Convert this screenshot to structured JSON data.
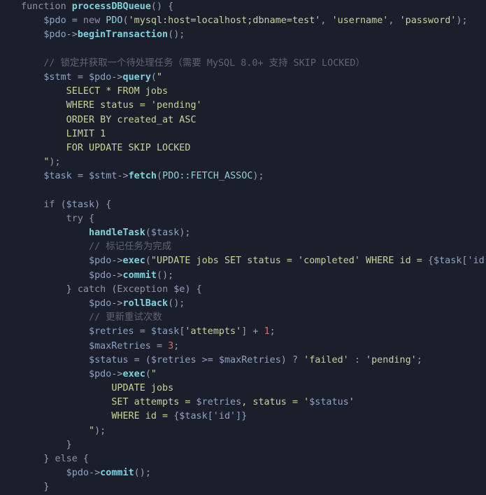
{
  "editor": {
    "language": "php",
    "theme_background": "#1b1f2b",
    "default_text_color": "#a9b1c2",
    "font_size_px": 13.4,
    "line_height_px": 20.2,
    "palette": {
      "keyword": "#8a93a8",
      "function_name": "#82d2d8",
      "method_name": "#7fd3e0",
      "variable": "#8fa3c4",
      "string": "#c3d69b",
      "comment": "#5c6576",
      "number": "#d2766b",
      "punctuation": "#97a0b3",
      "class_constant": "#8fd0d8"
    }
  },
  "code": {
    "title": "processDBQueue",
    "lines": [
      {
        "n": 1,
        "indent": 0,
        "tokens": [
          {
            "t": "function",
            "c": "kw"
          },
          {
            "t": " ",
            "c": "plain"
          },
          {
            "t": "processDBQueue",
            "c": "fnb"
          },
          {
            "t": "() {",
            "c": "punc"
          }
        ]
      },
      {
        "n": 2,
        "indent": 1,
        "tokens": [
          {
            "t": "$pdo",
            "c": "var"
          },
          {
            "t": " = ",
            "c": "op"
          },
          {
            "t": "new",
            "c": "kw"
          },
          {
            "t": " ",
            "c": "plain"
          },
          {
            "t": "PDO",
            "c": "const"
          },
          {
            "t": "(",
            "c": "punc"
          },
          {
            "t": "'mysql:host=localhost;dbname=test'",
            "c": "str"
          },
          {
            "t": ", ",
            "c": "punc"
          },
          {
            "t": "'username'",
            "c": "str"
          },
          {
            "t": ", ",
            "c": "punc"
          },
          {
            "t": "'password'",
            "c": "str"
          },
          {
            "t": ");",
            "c": "punc"
          }
        ]
      },
      {
        "n": 3,
        "indent": 1,
        "tokens": [
          {
            "t": "$pdo",
            "c": "var"
          },
          {
            "t": "->",
            "c": "op"
          },
          {
            "t": "beginTransaction",
            "c": "meth"
          },
          {
            "t": "();",
            "c": "punc"
          }
        ]
      },
      {
        "n": 4,
        "indent": 0,
        "tokens": []
      },
      {
        "n": 5,
        "indent": 1,
        "tokens": [
          {
            "t": "// 锁定并获取一个待处理任务（需要 MySQL 8.0+ 支持 SKIP LOCKED）",
            "c": "cmt"
          }
        ]
      },
      {
        "n": 6,
        "indent": 1,
        "tokens": [
          {
            "t": "$stmt",
            "c": "var"
          },
          {
            "t": " = ",
            "c": "op"
          },
          {
            "t": "$pdo",
            "c": "var"
          },
          {
            "t": "->",
            "c": "op"
          },
          {
            "t": "query",
            "c": "meth"
          },
          {
            "t": "(",
            "c": "punc"
          },
          {
            "t": "\"",
            "c": "str"
          }
        ]
      },
      {
        "n": 7,
        "indent": 2,
        "tokens": [
          {
            "t": "SELECT * FROM jobs",
            "c": "sql"
          }
        ]
      },
      {
        "n": 8,
        "indent": 2,
        "tokens": [
          {
            "t": "WHERE status = 'pending'",
            "c": "sql"
          }
        ]
      },
      {
        "n": 9,
        "indent": 2,
        "tokens": [
          {
            "t": "ORDER BY created_at ASC",
            "c": "sql"
          }
        ]
      },
      {
        "n": 10,
        "indent": 2,
        "tokens": [
          {
            "t": "LIMIT 1",
            "c": "sql"
          }
        ]
      },
      {
        "n": 11,
        "indent": 2,
        "tokens": [
          {
            "t": "FOR UPDATE SKIP LOCKED",
            "c": "sql"
          }
        ]
      },
      {
        "n": 12,
        "indent": 1,
        "tokens": [
          {
            "t": "\"",
            "c": "str"
          },
          {
            "t": ");",
            "c": "punc"
          }
        ]
      },
      {
        "n": 13,
        "indent": 1,
        "tokens": [
          {
            "t": "$task",
            "c": "var"
          },
          {
            "t": " = ",
            "c": "op"
          },
          {
            "t": "$stmt",
            "c": "var"
          },
          {
            "t": "->",
            "c": "op"
          },
          {
            "t": "fetch",
            "c": "meth"
          },
          {
            "t": "(",
            "c": "punc"
          },
          {
            "t": "PDO::FETCH_ASSOC",
            "c": "const"
          },
          {
            "t": ");",
            "c": "punc"
          }
        ]
      },
      {
        "n": 14,
        "indent": 0,
        "tokens": []
      },
      {
        "n": 15,
        "indent": 1,
        "tokens": [
          {
            "t": "if",
            "c": "kw"
          },
          {
            "t": " (",
            "c": "punc"
          },
          {
            "t": "$task",
            "c": "var"
          },
          {
            "t": ") {",
            "c": "punc"
          }
        ]
      },
      {
        "n": 16,
        "indent": 2,
        "tokens": [
          {
            "t": "try",
            "c": "kw"
          },
          {
            "t": " {",
            "c": "punc"
          }
        ]
      },
      {
        "n": 17,
        "indent": 3,
        "tokens": [
          {
            "t": "handleTask",
            "c": "fnb"
          },
          {
            "t": "(",
            "c": "punc"
          },
          {
            "t": "$task",
            "c": "var"
          },
          {
            "t": ");",
            "c": "punc"
          }
        ]
      },
      {
        "n": 18,
        "indent": 3,
        "tokens": [
          {
            "t": "// 标记任务为完成",
            "c": "cmt"
          }
        ]
      },
      {
        "n": 19,
        "indent": 3,
        "tokens": [
          {
            "t": "$pdo",
            "c": "var"
          },
          {
            "t": "->",
            "c": "op"
          },
          {
            "t": "exec",
            "c": "meth"
          },
          {
            "t": "(",
            "c": "punc"
          },
          {
            "t": "\"UPDATE jobs SET status = 'completed' WHERE id = ",
            "c": "str"
          },
          {
            "t": "{$task['id']}",
            "c": "interp"
          },
          {
            "t": "\"",
            "c": "str"
          },
          {
            "t": ");",
            "c": "punc"
          }
        ]
      },
      {
        "n": 20,
        "indent": 3,
        "tokens": [
          {
            "t": "$pdo",
            "c": "var"
          },
          {
            "t": "->",
            "c": "op"
          },
          {
            "t": "commit",
            "c": "meth"
          },
          {
            "t": "();",
            "c": "punc"
          }
        ]
      },
      {
        "n": 21,
        "indent": 2,
        "tokens": [
          {
            "t": "} ",
            "c": "punc"
          },
          {
            "t": "catch",
            "c": "kw"
          },
          {
            "t": " (",
            "c": "punc"
          },
          {
            "t": "Exception",
            "c": "kw"
          },
          {
            "t": " ",
            "c": "plain"
          },
          {
            "t": "$e",
            "c": "var"
          },
          {
            "t": ") {",
            "c": "punc"
          }
        ]
      },
      {
        "n": 22,
        "indent": 3,
        "tokens": [
          {
            "t": "$pdo",
            "c": "var"
          },
          {
            "t": "->",
            "c": "op"
          },
          {
            "t": "rollBack",
            "c": "meth"
          },
          {
            "t": "();",
            "c": "punc"
          }
        ]
      },
      {
        "n": 23,
        "indent": 3,
        "tokens": [
          {
            "t": "// 更新重试次数",
            "c": "cmt"
          }
        ]
      },
      {
        "n": 24,
        "indent": 3,
        "tokens": [
          {
            "t": "$retries",
            "c": "var"
          },
          {
            "t": " = ",
            "c": "op"
          },
          {
            "t": "$task",
            "c": "var"
          },
          {
            "t": "[",
            "c": "punc"
          },
          {
            "t": "'attempts'",
            "c": "str"
          },
          {
            "t": "] + ",
            "c": "punc"
          },
          {
            "t": "1",
            "c": "num"
          },
          {
            "t": ";",
            "c": "punc"
          }
        ]
      },
      {
        "n": 25,
        "indent": 3,
        "tokens": [
          {
            "t": "$maxRetries",
            "c": "var"
          },
          {
            "t": " = ",
            "c": "op"
          },
          {
            "t": "3",
            "c": "num"
          },
          {
            "t": ";",
            "c": "punc"
          }
        ]
      },
      {
        "n": 26,
        "indent": 3,
        "tokens": [
          {
            "t": "$status",
            "c": "var"
          },
          {
            "t": " = (",
            "c": "punc"
          },
          {
            "t": "$retries",
            "c": "var"
          },
          {
            "t": " >= ",
            "c": "op"
          },
          {
            "t": "$maxRetries",
            "c": "var"
          },
          {
            "t": ") ? ",
            "c": "punc"
          },
          {
            "t": "'failed'",
            "c": "str"
          },
          {
            "t": " : ",
            "c": "punc"
          },
          {
            "t": "'pending'",
            "c": "str"
          },
          {
            "t": ";",
            "c": "punc"
          }
        ]
      },
      {
        "n": 27,
        "indent": 3,
        "tokens": [
          {
            "t": "$pdo",
            "c": "var"
          },
          {
            "t": "->",
            "c": "op"
          },
          {
            "t": "exec",
            "c": "meth"
          },
          {
            "t": "(",
            "c": "punc"
          },
          {
            "t": "\"",
            "c": "str"
          }
        ]
      },
      {
        "n": 28,
        "indent": 4,
        "tokens": [
          {
            "t": "UPDATE jobs",
            "c": "sql"
          }
        ]
      },
      {
        "n": 29,
        "indent": 4,
        "tokens": [
          {
            "t": "SET attempts = ",
            "c": "sql"
          },
          {
            "t": "$retries",
            "c": "interp"
          },
          {
            "t": ", status = '",
            "c": "sql"
          },
          {
            "t": "$status",
            "c": "interp"
          },
          {
            "t": "'",
            "c": "sql"
          }
        ]
      },
      {
        "n": 30,
        "indent": 4,
        "tokens": [
          {
            "t": "WHERE id = ",
            "c": "sql"
          },
          {
            "t": "{$task['id']}",
            "c": "interp"
          }
        ]
      },
      {
        "n": 31,
        "indent": 3,
        "tokens": [
          {
            "t": "\"",
            "c": "str"
          },
          {
            "t": ");",
            "c": "punc"
          }
        ]
      },
      {
        "n": 32,
        "indent": 2,
        "tokens": [
          {
            "t": "}",
            "c": "punc"
          }
        ]
      },
      {
        "n": 33,
        "indent": 1,
        "tokens": [
          {
            "t": "} ",
            "c": "punc"
          },
          {
            "t": "else",
            "c": "kw"
          },
          {
            "t": " {",
            "c": "punc"
          }
        ]
      },
      {
        "n": 34,
        "indent": 2,
        "tokens": [
          {
            "t": "$pdo",
            "c": "var"
          },
          {
            "t": "->",
            "c": "op"
          },
          {
            "t": "commit",
            "c": "meth"
          },
          {
            "t": "();",
            "c": "punc"
          }
        ]
      },
      {
        "n": 35,
        "indent": 1,
        "tokens": [
          {
            "t": "}",
            "c": "punc"
          }
        ]
      }
    ]
  }
}
